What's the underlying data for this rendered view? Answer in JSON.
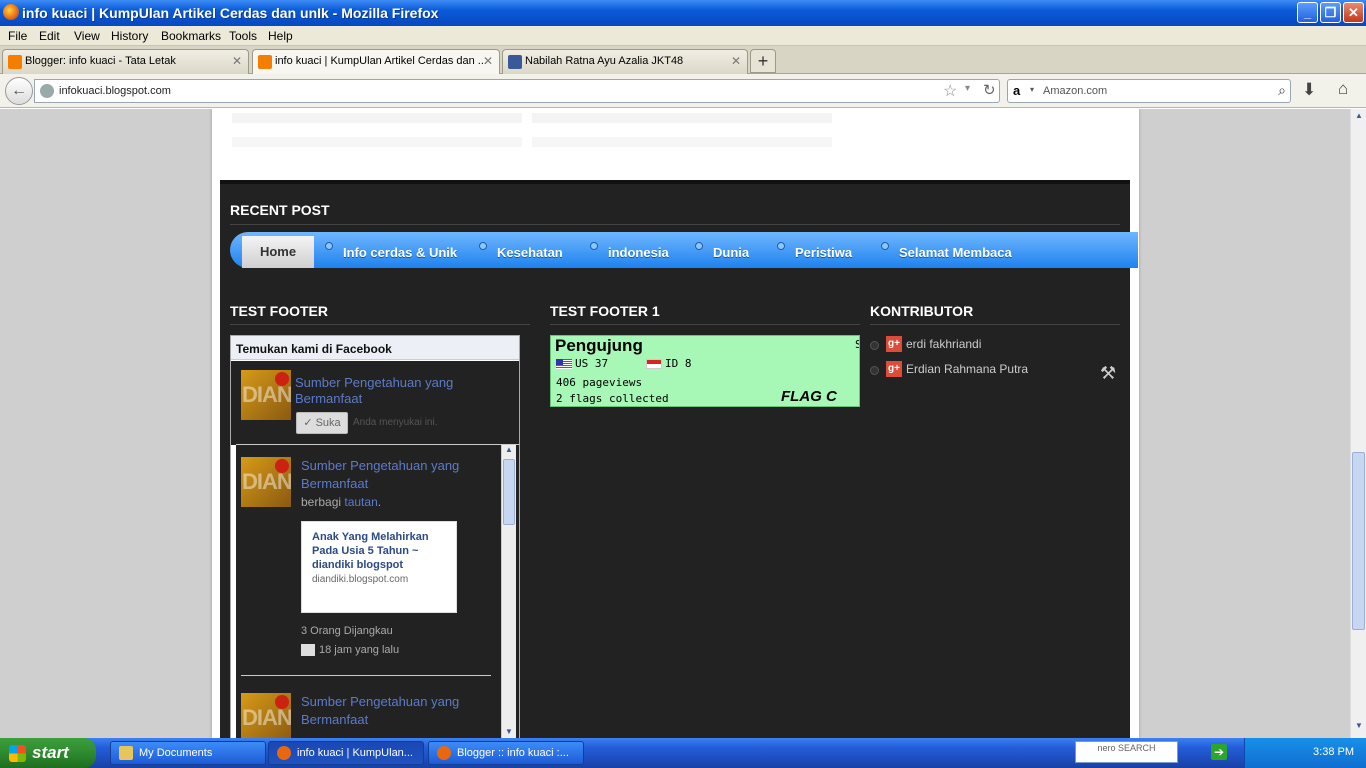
{
  "window": {
    "title": "info kuaci | KumpUlan Artikel Cerdas dan unIk - Mozilla Firefox",
    "buttons": {
      "minimize": "_",
      "maximize": "❐",
      "close": "✕"
    }
  },
  "menubar": [
    "File",
    "Edit",
    "View",
    "History",
    "Bookmarks",
    "Tools",
    "Help"
  ],
  "tabs": [
    {
      "label": "Blogger: info kuaci - Tata Letak",
      "close": "✕"
    },
    {
      "label": "info kuaci | KumpUlan Artikel Cerdas dan ...",
      "close": "✕"
    },
    {
      "label": "Nabilah Ratna Ayu Azalia JKT48",
      "close": "✕"
    }
  ],
  "new_tab": "+",
  "navbar": {
    "back": "←",
    "url": "infokuaci.blogspot.com",
    "star": "☆",
    "dropdown": "▾",
    "reload": "↻",
    "search_logo": "a",
    "search_placeholder": "Amazon.com",
    "search_icon": "⌕",
    "download": "⬇",
    "home": "⌂"
  },
  "page": {
    "recent_post": "RECENT POST",
    "menu": {
      "home": "Home",
      "items": [
        "Info cerdas & Unik",
        "Kesehatan",
        "indonesia",
        "Dunia",
        "Peristiwa",
        "Selamat Membaca"
      ]
    },
    "footer_titles": [
      "TEST FOOTER",
      "TEST FOOTER 1",
      "KONTRIBUTOR"
    ],
    "facebook": {
      "header": "Temukan kami di Facebook",
      "thumb_text": "DIAN",
      "page_name": "Sumber Pengetahuan yang Bermanfaat",
      "like": "✓ Suka",
      "like_note": "Anda menyukai ini.",
      "posts": [
        {
          "author": "Sumber Pengetahuan yang Bermanfaat",
          "action": "berbagi",
          "link_word": "tautan",
          "dot": ".",
          "card_title": "Anak Yang Melahirkan Pada Usia 5 Tahun ~ diandiki blogspot",
          "card_domain": "diandiki.blogspot.com",
          "reach": "3 Orang Dijangkau",
          "time": "18 jam yang lalu"
        },
        {
          "author": "Sumber Pengetahuan yang Bermanfaat"
        }
      ],
      "scroll_up": "▲",
      "scroll_down": "▼"
    },
    "flag_counter": {
      "title": "Pengujung",
      "edge_letter": "S",
      "countries": [
        {
          "code": "US",
          "count": "37"
        },
        {
          "code": "ID",
          "count": "8"
        }
      ],
      "pageviews": "406 pageviews",
      "flags_collected": "2 flags collected",
      "logo": "FLAG C"
    },
    "contributors": [
      "erdi fakhriandi",
      "Erdian Rahmana Putra"
    ],
    "gplus": "g+",
    "tools_icon": "⚒"
  },
  "scrollbar": {
    "up": "▲",
    "down": "▼"
  },
  "taskbar": {
    "start": "start",
    "buttons": [
      "My Documents",
      "info kuaci | KumpUlan...",
      "Blogger :: info kuaci :..."
    ],
    "search_brand": "nero SEARCH",
    "go": "➔",
    "clock": "3:38 PM"
  }
}
